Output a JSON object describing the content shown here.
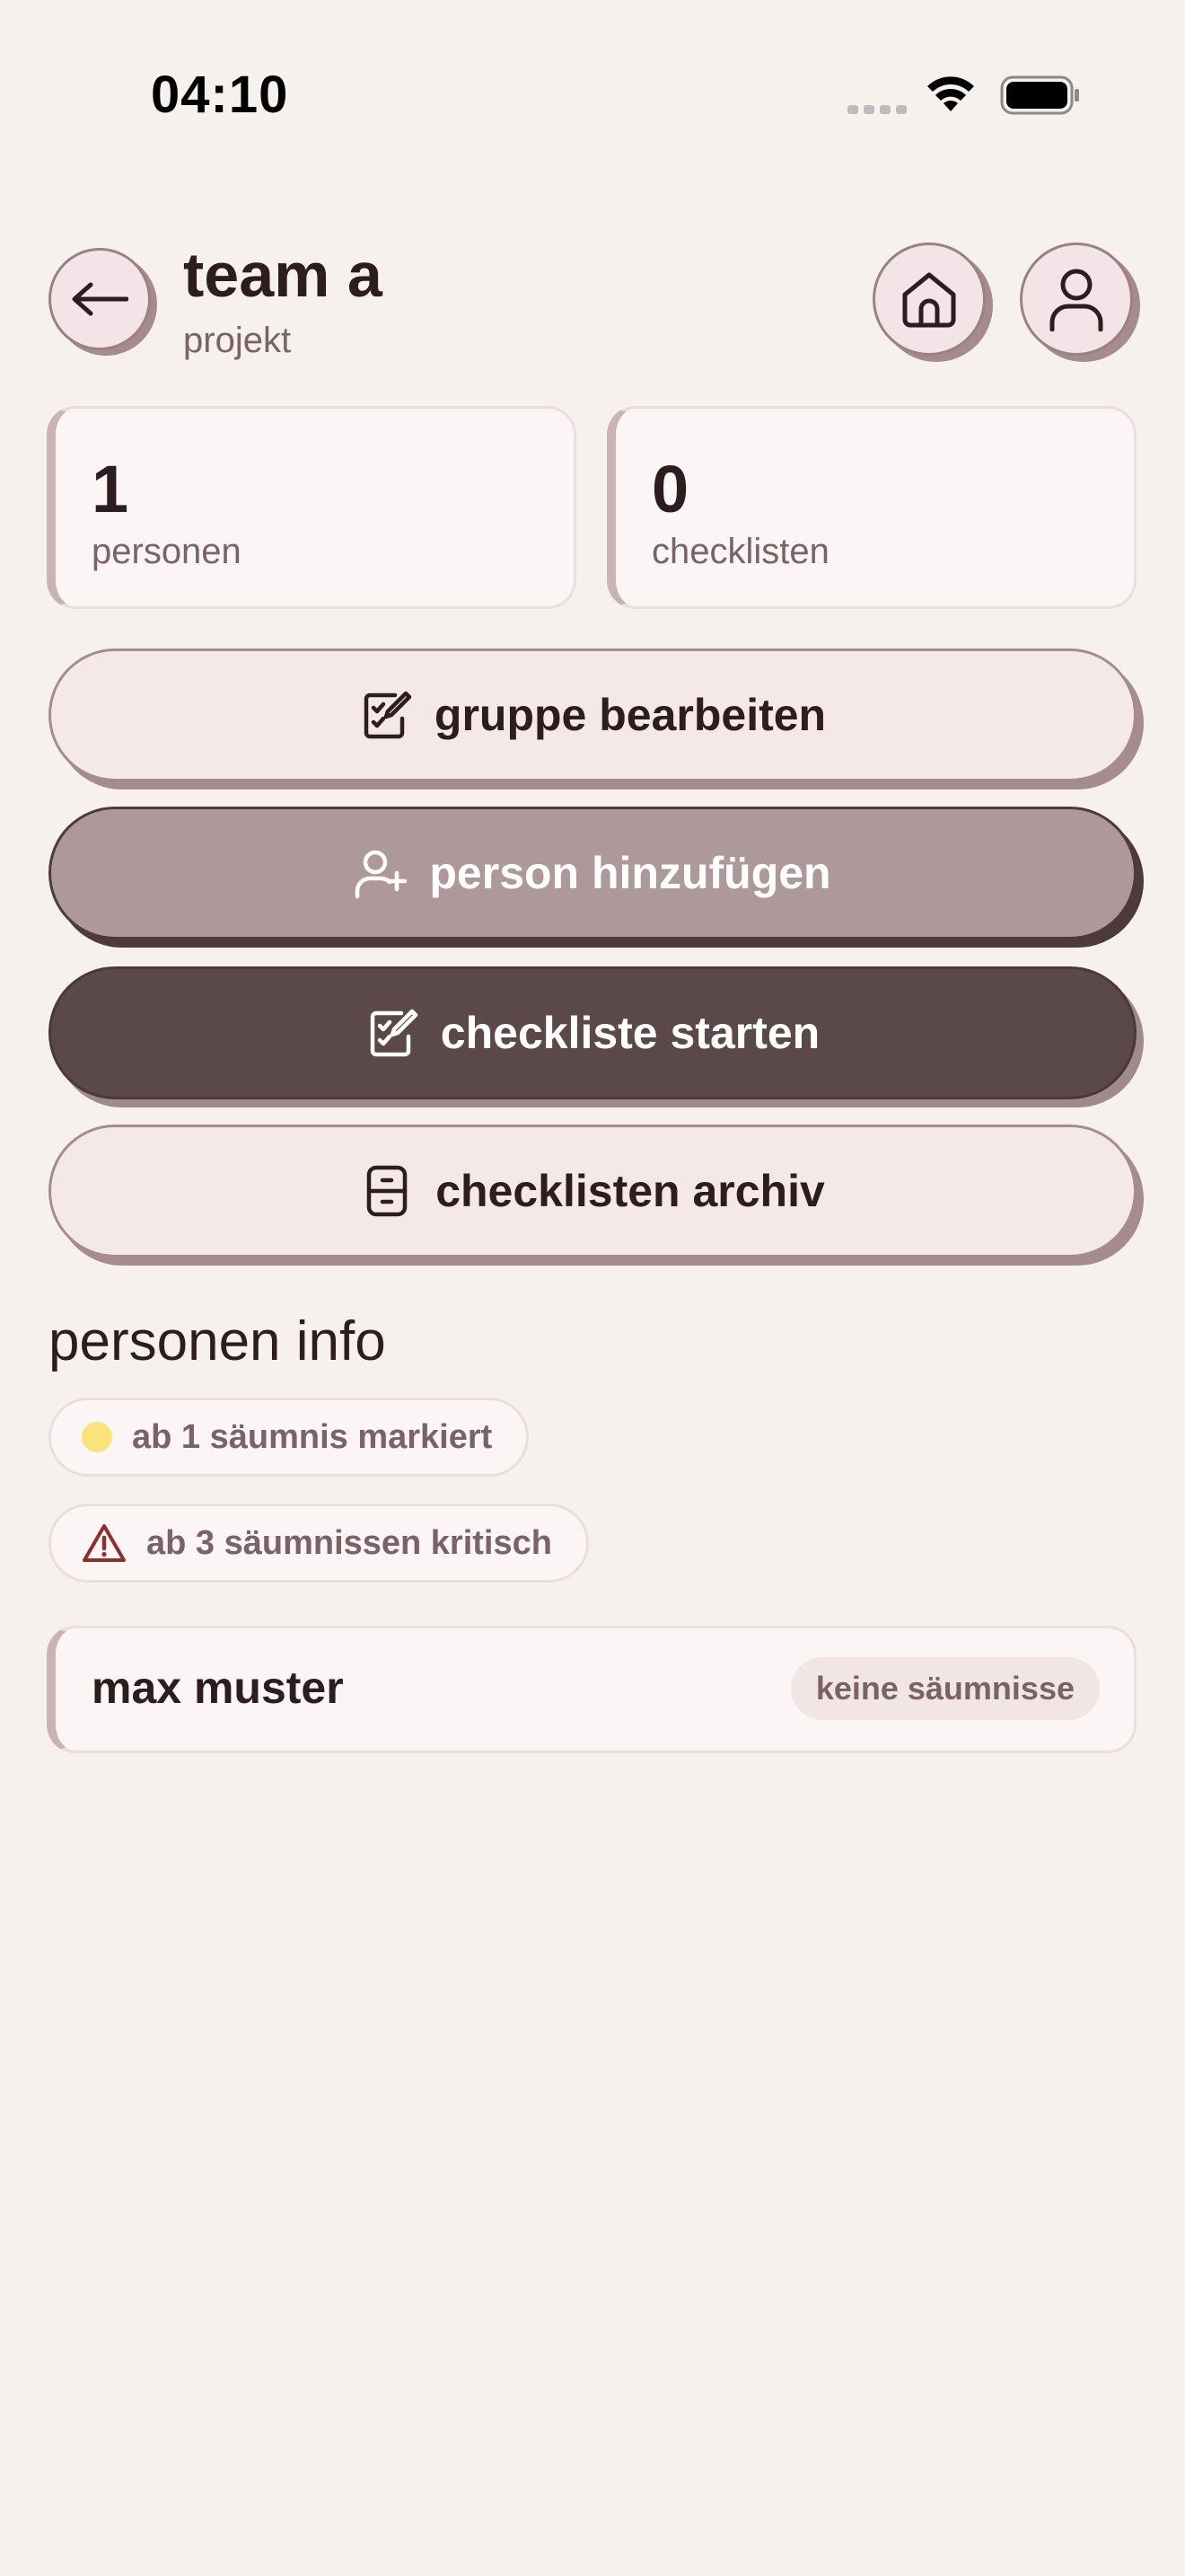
{
  "status_bar": {
    "time": "04:10"
  },
  "header": {
    "title": "team a",
    "subtitle": "projekt",
    "back_icon": "arrow-left-icon",
    "home_icon": "home-icon",
    "profile_icon": "user-icon"
  },
  "stats": [
    {
      "value": "1",
      "label": "personen"
    },
    {
      "value": "0",
      "label": "checklisten"
    }
  ],
  "actions": {
    "edit_group": {
      "label": "gruppe bearbeiten",
      "icon": "edit-checklist-icon"
    },
    "add_person": {
      "label": "person hinzufügen",
      "icon": "user-plus-icon"
    },
    "start_checklist": {
      "label": "checkliste starten",
      "icon": "edit-checklist-icon"
    },
    "archive": {
      "label": "checklisten archiv",
      "icon": "archive-cabinet-icon"
    }
  },
  "info": {
    "title": "personen info",
    "legend": [
      {
        "text": "ab 1 säumnis markiert",
        "icon": "yellow-dot-icon"
      },
      {
        "text": "ab 3 säumnissen kritisch",
        "icon": "warning-triangle-icon"
      }
    ]
  },
  "persons": [
    {
      "name": "max muster",
      "status": "keine säumnisse"
    }
  ],
  "colors": {
    "background": "#f7f1ee",
    "text_primary": "#2e1d1f",
    "text_secondary": "#7a6266",
    "button_light": "#f4e9e7",
    "button_mid": "#ae999a",
    "button_dark": "#5b4849",
    "marker_yellow": "#f9e37a",
    "warning_red": "#8e2f2f"
  }
}
